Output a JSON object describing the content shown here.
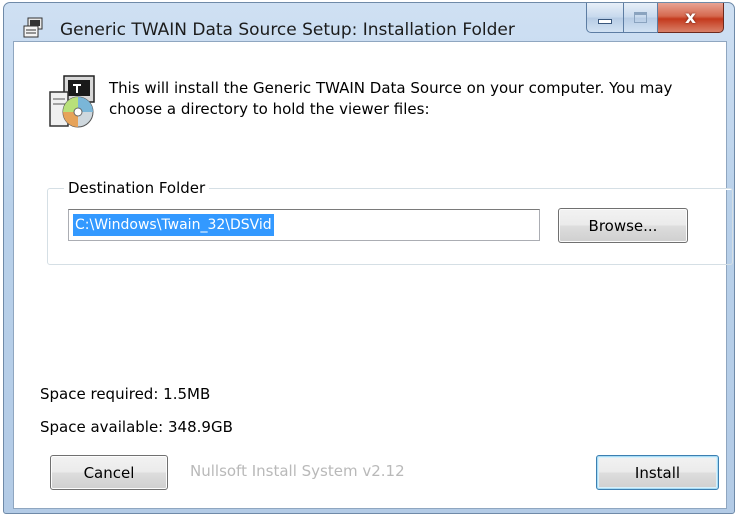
{
  "window": {
    "title": "Generic TWAIN Data Source Setup: Installation Folder",
    "caption_buttons": {
      "minimize_icon": "minimize-icon",
      "maximize_icon": "maximize-icon",
      "close_glyph": "x"
    }
  },
  "header": {
    "icon": "installer-disc-icon",
    "intro_text": "This will install the Generic TWAIN Data Source on your computer.  You may choose a directory to hold the viewer files:"
  },
  "destination": {
    "group_label": "Destination Folder",
    "path_value": "C:\\Windows\\Twain_32\\DSVid",
    "browse_label": "Browse..."
  },
  "space": {
    "required": "Space required: 1.5MB",
    "available": "Space available: 348.9GB"
  },
  "footer": {
    "cancel_label": "Cancel",
    "branding": "Nullsoft Install System v2.12",
    "install_label": "Install"
  },
  "colors": {
    "selection": "#3399ff",
    "close_button": "#c4391d",
    "titlebar": "#b9d1ea"
  }
}
